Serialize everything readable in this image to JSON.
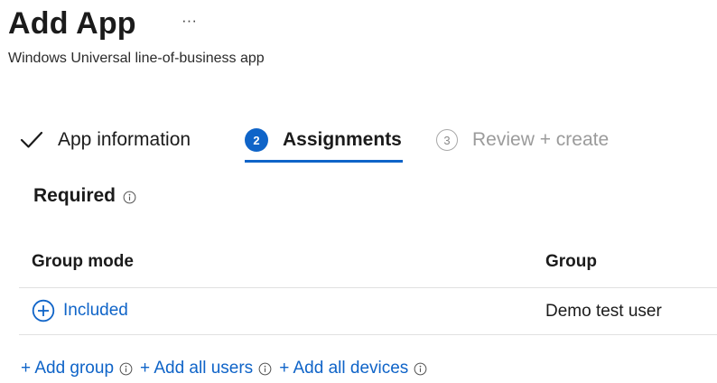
{
  "header": {
    "title": "Add App",
    "more_label": "···",
    "subtitle": "Windows Universal line-of-business app"
  },
  "wizard": {
    "steps": [
      {
        "label": "App information",
        "state": "completed",
        "icon": "check-icon"
      },
      {
        "number": "2",
        "label": "Assignments",
        "state": "active"
      },
      {
        "number": "3",
        "label": "Review + create",
        "state": "upcoming"
      }
    ]
  },
  "section": {
    "title": "Required",
    "info_icon": "info-icon"
  },
  "table": {
    "columns": [
      "Group mode",
      "Group"
    ],
    "rows": [
      {
        "mode": "Included",
        "mode_icon": "plus-circle-icon",
        "group": "Demo test user"
      }
    ]
  },
  "add_actions": [
    {
      "label": "+ Add group"
    },
    {
      "label": "+ Add all users"
    },
    {
      "label": "+ Add all devices"
    }
  ],
  "colors": {
    "accent": "#0f64c8",
    "text": "#1b1b1b",
    "muted": "#9b9b9b",
    "divider": "#e1e1e1"
  }
}
